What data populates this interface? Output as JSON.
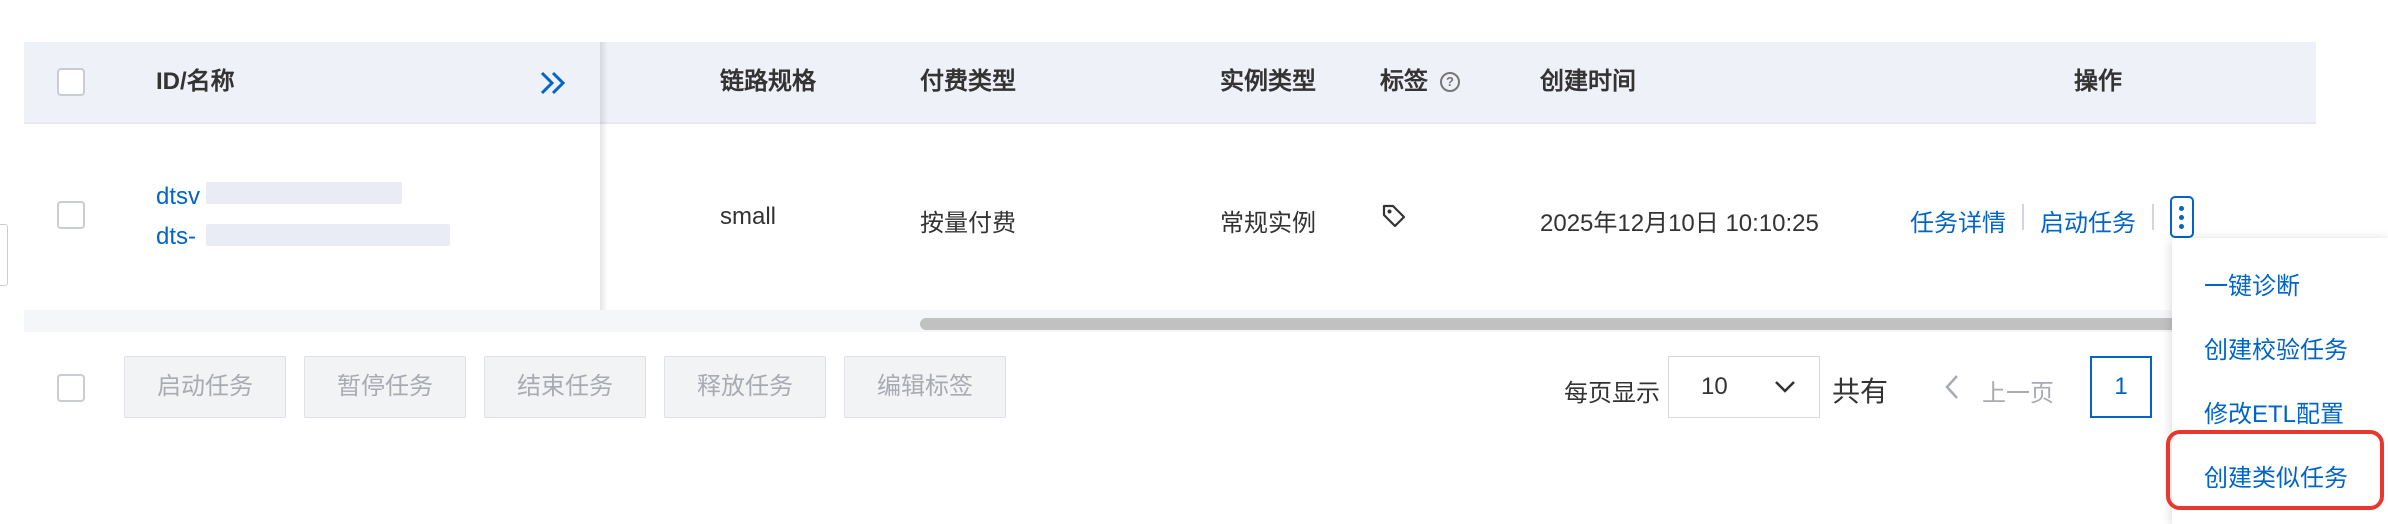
{
  "table": {
    "columns": {
      "id_name": "ID/名称",
      "link_spec": "链路规格",
      "pay_type": "付费类型",
      "instance_type": "实例类型",
      "tags": "标签",
      "created": "创建时间",
      "actions": "操作"
    },
    "row": {
      "id": "dtsv",
      "name": "dts-",
      "link_spec": "small",
      "pay_type": "按量付费",
      "instance_type": "常规实例",
      "created": "2025年12月10日 10:10:25",
      "action_detail": "任务详情",
      "action_start": "启动任务"
    }
  },
  "batch_actions": {
    "start": "启动任务",
    "pause": "暂停任务",
    "end": "结束任务",
    "release": "释放任务",
    "edit_tags": "编辑标签"
  },
  "pagination": {
    "per_page_label": "每页显示",
    "per_page_value": "10",
    "total_label": "共有",
    "prev_label": "上一页",
    "current_page": "1"
  },
  "dropdown_menu": {
    "items": [
      "一键诊断",
      "创建校验任务",
      "修改ETL配置",
      "创建类似任务"
    ],
    "highlighted": "创建类似任务"
  },
  "colors": {
    "link": "#0064c8",
    "header_bg": "#eef1f8",
    "highlight": "#e8372d"
  }
}
